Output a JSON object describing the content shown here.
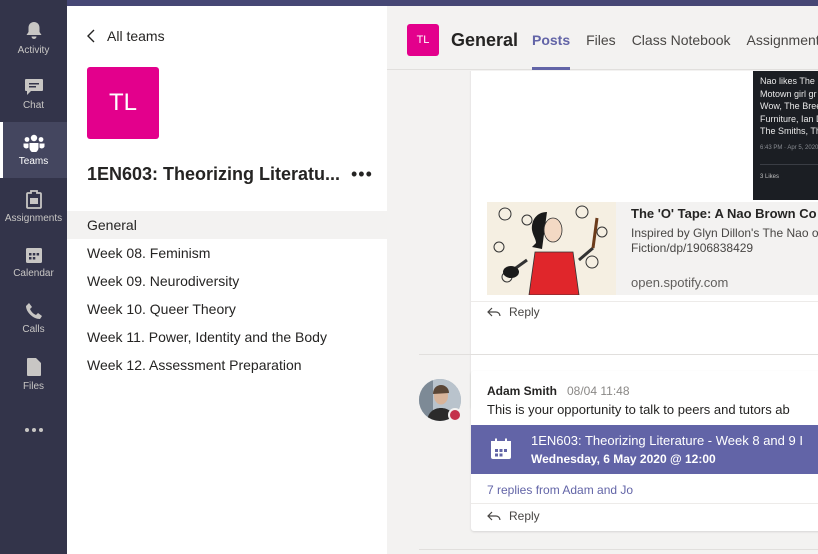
{
  "rail": [
    {
      "id": "activity",
      "label": "Activity",
      "icon": "bell-icon",
      "active": false
    },
    {
      "id": "chat",
      "label": "Chat",
      "icon": "chat-icon",
      "active": false
    },
    {
      "id": "teams",
      "label": "Teams",
      "icon": "teams-icon",
      "active": true
    },
    {
      "id": "assignments",
      "label": "Assignments",
      "icon": "assignments-icon",
      "active": false
    },
    {
      "id": "calendar",
      "label": "Calendar",
      "icon": "calendar-icon",
      "active": false
    },
    {
      "id": "calls",
      "label": "Calls",
      "icon": "phone-icon",
      "active": false
    },
    {
      "id": "files",
      "label": "Files",
      "icon": "file-icon",
      "active": false
    },
    {
      "id": "more",
      "label": "",
      "icon": "more-apps-icon",
      "active": false
    }
  ],
  "team": {
    "back_label": "All teams",
    "avatar_initials": "TL",
    "name": "1EN603: Theorizing Literatu...",
    "more_label": "•••",
    "channels": [
      "General",
      "Week 08. Feminism",
      "Week 09. Neurodiversity",
      "Week 10. Queer Theory",
      "Week 11. Power, Identity and the Body",
      "Week 12. Assessment Preparation"
    ]
  },
  "header": {
    "avatar_initials": "TL",
    "title": "General",
    "tabs": [
      "Posts",
      "Files",
      "Class Notebook",
      "Assignments"
    ]
  },
  "post1": {
    "tweet_lines": [
      "Nao likes The",
      "Motown girl gr",
      "Wow, The Bree",
      "Furniture, Ian D",
      "The Smiths, Th"
    ],
    "tweet_meta": "6:43 PM · Apr 5, 2020",
    "tweet_likes": "3 Likes",
    "link_title": "The 'O' Tape: A Nao Brown Co",
    "link_desc_1": "Inspired by Glyn Dillon's The Nao o",
    "link_desc_2": "Fiction/dp/1906838429",
    "link_domain": "open.spotify.com",
    "reply_label": "Reply"
  },
  "post2": {
    "author": "Adam Smith",
    "time": "08/04 11:48",
    "message": "This is your opportunity to talk to peers and tutors ab",
    "meeting_title": "1EN603: Theorizing Literature - Week 8 and 9 I",
    "meeting_date": "Wednesday, 6 May 2020 @ 12:00",
    "replies_link": "7 replies from Adam and Jo",
    "reply_label": "Reply"
  },
  "colors": {
    "rail": "#33344a",
    "accent": "#6264a7",
    "team_avatar": "#e3008c",
    "presence_busy": "#c4314b"
  }
}
